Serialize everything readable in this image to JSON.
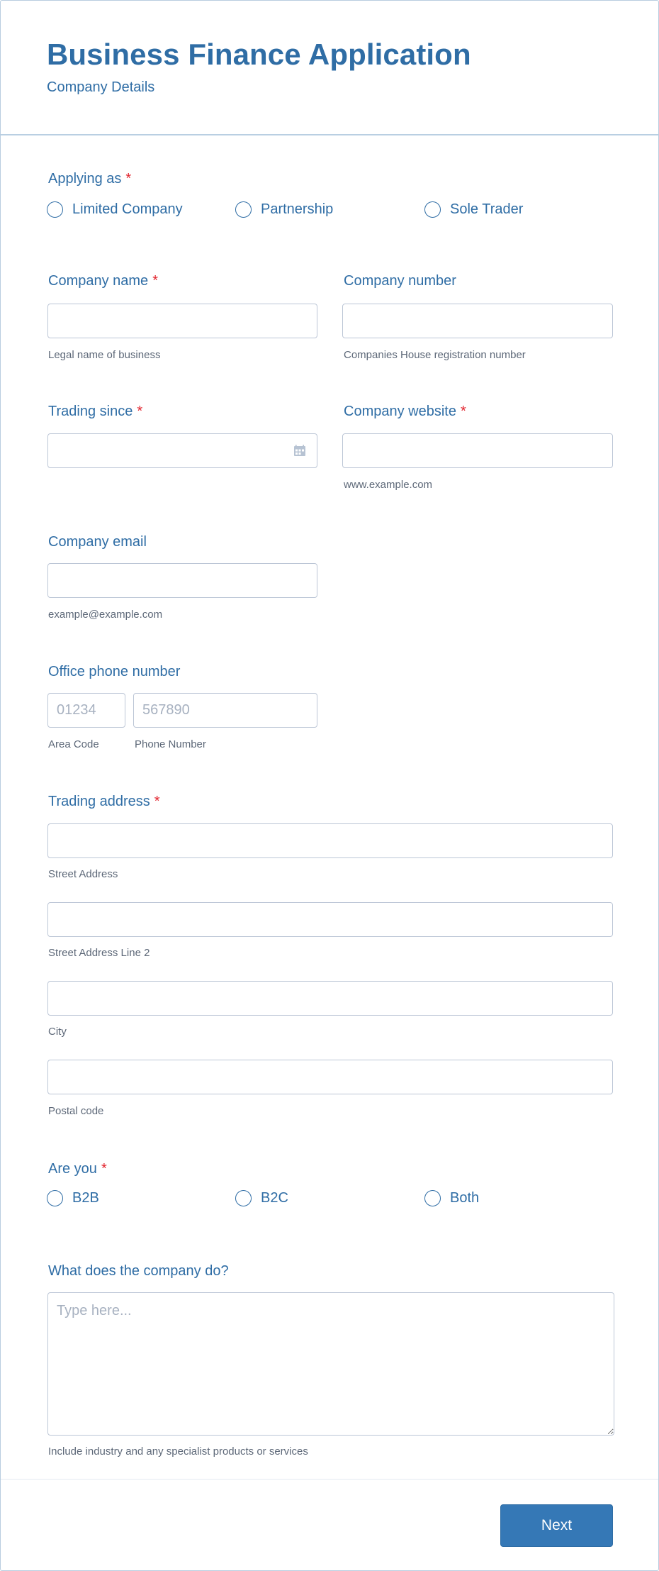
{
  "header": {
    "title": "Business Finance Application",
    "subtitle": "Company Details"
  },
  "applying_as": {
    "label": "Applying as",
    "required_mark": "*",
    "options": [
      "Limited Company",
      "Partnership",
      "Sole Trader"
    ],
    "selected": null
  },
  "company_name": {
    "label": "Company name",
    "required_mark": "*",
    "value": "",
    "help": "Legal name of business"
  },
  "company_number": {
    "label": "Company number",
    "value": "",
    "help": "Companies House registration number"
  },
  "trading_since": {
    "label": "Trading since",
    "required_mark": "*",
    "value": "",
    "icon": "calendar-icon"
  },
  "company_website": {
    "label": "Company website",
    "required_mark": "*",
    "value": "",
    "help": "www.example.com"
  },
  "company_email": {
    "label": "Company email",
    "value": "",
    "help": "example@example.com"
  },
  "office_phone": {
    "label": "Office phone number",
    "area_code": {
      "placeholder": "01234",
      "value": "",
      "help": "Area Code"
    },
    "phone_number": {
      "placeholder": "567890",
      "value": "",
      "help": "Phone Number"
    }
  },
  "trading_address": {
    "label": "Trading address",
    "required_mark": "*",
    "fields": [
      {
        "value": "",
        "help": "Street Address"
      },
      {
        "value": "",
        "help": "Street Address Line 2"
      },
      {
        "value": "",
        "help": "City"
      },
      {
        "value": "",
        "help": "Postal code"
      }
    ]
  },
  "are_you": {
    "label": "Are you",
    "required_mark": "*",
    "options": [
      "B2B",
      "B2C",
      "Both"
    ],
    "selected": null
  },
  "company_activity": {
    "label": "What does the company do?",
    "placeholder": "Type here...",
    "value": "",
    "help": "Include industry and any specialist products or services"
  },
  "footer": {
    "next_label": "Next"
  },
  "colors": {
    "primary": "#2f6da5",
    "button": "#3578b6",
    "required": "#e2252f",
    "input_border": "#bcc6d6",
    "help_text": "#5d6878"
  }
}
